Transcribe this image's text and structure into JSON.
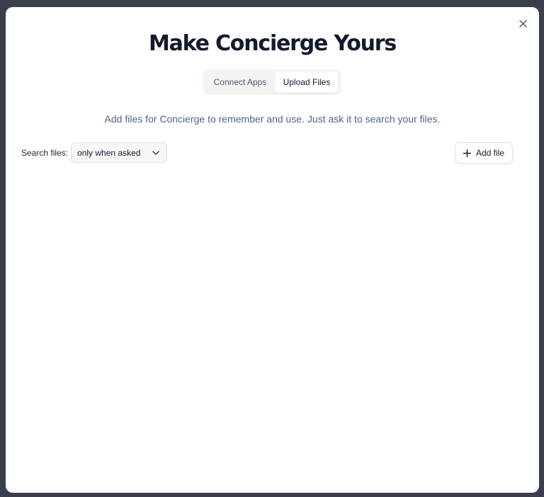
{
  "modal": {
    "title": "Make Concierge Yours",
    "close_icon": "close-icon",
    "tabs": [
      {
        "label": "Connect Apps",
        "active": false
      },
      {
        "label": "Upload Files",
        "active": true
      }
    ],
    "subtitle": "Add files for Concierge to remember and use. Just ask it to search your files.",
    "search": {
      "label": "Search files:",
      "selected_value": "only when asked",
      "dropdown_icon": "chevron-down-icon"
    },
    "add_file": {
      "label": "Add file",
      "icon": "plus-icon"
    }
  },
  "colors": {
    "backdrop": "#3b3f4d",
    "title": "#131a2e",
    "subtitle": "#4f6484",
    "tab_track": "#f6f2f1"
  }
}
